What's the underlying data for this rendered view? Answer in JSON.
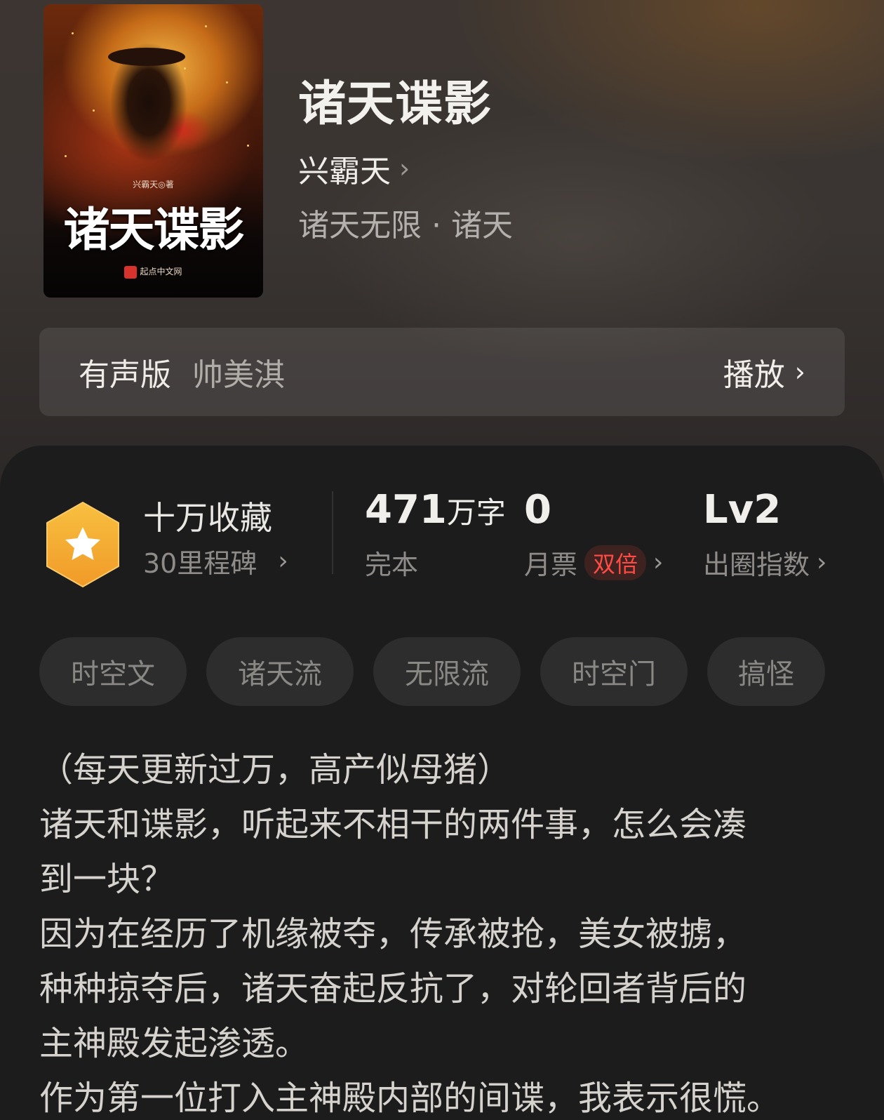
{
  "book": {
    "title": "诸天谍影",
    "author": "兴霸天",
    "category": "诸天无限 · 诸天",
    "cover": {
      "author_line": "兴霸天◎著",
      "title": "诸天谍影",
      "publisher": "起点中文网"
    }
  },
  "audio": {
    "label": "有声版",
    "narrator": "帅美淇",
    "play_label": "播放"
  },
  "stats": {
    "collection_title": "十万收藏",
    "collection_sub": "30里程碑",
    "word_count": "471",
    "word_unit": "万字",
    "status": "完本",
    "monthly_ticket_count": "0",
    "monthly_ticket_label": "月票",
    "double_badge": "双倍",
    "circle_level": "Lv2",
    "circle_label": "出圈指数",
    "badge_color": "#f5b23c"
  },
  "tags": [
    "时空文",
    "诸天流",
    "无限流",
    "时空门",
    "搞怪"
  ],
  "synopsis": [
    "（每天更新过万，高产似母猪）",
    "诸天和谍影，听起来不相干的两件事，怎么会凑",
    "到一块？",
    "因为在经历了机缘被夺，传承被抢，美女被掳，",
    "种种掠夺后，诸天奋起反抗了，对轮回者背后的",
    "主神殿发起渗透。",
    "作为第一位打入主神殿内部的间谍，我表示很慌。"
  ]
}
